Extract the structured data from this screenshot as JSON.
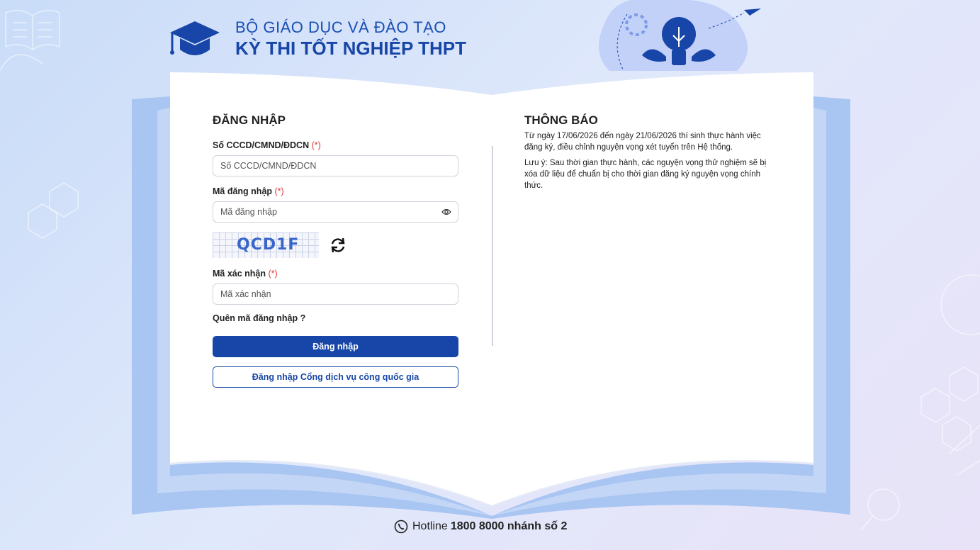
{
  "header": {
    "ministry": "BỘ GIÁO DỤC VÀ ĐÀO TẠO",
    "exam": "KỲ THI TỐT NGHIỆP THPT"
  },
  "login": {
    "title": "ĐĂNG NHẬP",
    "id_label": "Số CCCD/CMND/ĐDCN",
    "id_placeholder": "Số CCCD/CMND/ĐDCN",
    "id_value": "",
    "password_label": "Mã đăng nhập",
    "password_placeholder": "Mã đăng nhập",
    "password_value": "",
    "required_mark": "(*)",
    "captcha_text": "QCD1F",
    "captcha_label": "Mã xác nhận",
    "captcha_placeholder": "Mã xác nhận",
    "captcha_value": "",
    "forgot": "Quên mã đăng nhập ?",
    "login_button": "Đăng nhập",
    "national_portal_button": "Đăng nhập Cổng dịch vụ công quốc gia"
  },
  "notice": {
    "title": "THÔNG BÁO",
    "paragraph1": "Từ ngày 17/06/2026 đến ngày 21/06/2026 thí sinh thực hành việc đăng ký, điều chỉnh nguyện vọng xét tuyển trên Hệ thống.",
    "paragraph2": "Lưu ý: Sau thời gian thực hành, các nguyện vọng thử nghiệm sẽ bị xóa dữ liệu để chuẩn bị cho thời gian đăng ký nguyện vọng chính thức."
  },
  "footer": {
    "hotline_label": "Hotline",
    "hotline_number": "1800 8000 nhánh số 2"
  },
  "icons": {
    "logo": "graduation-cap-icon",
    "eye": "eye-icon",
    "refresh": "refresh-icon",
    "phone": "phone-icon"
  },
  "colors": {
    "brand": "#1746a8",
    "required": "#dd3333",
    "background": "#d6e3f9"
  }
}
